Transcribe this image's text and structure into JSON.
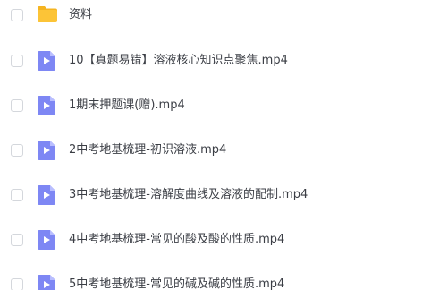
{
  "files": [
    {
      "type": "folder",
      "name": "资料"
    },
    {
      "type": "video",
      "name": "10【真题易错】溶液核心知识点聚焦.mp4"
    },
    {
      "type": "video",
      "name": "1期末押题课(赠).mp4"
    },
    {
      "type": "video",
      "name": "2中考地基梳理-初识溶液.mp4"
    },
    {
      "type": "video",
      "name": "3中考地基梳理-溶解度曲线及溶液的配制.mp4"
    },
    {
      "type": "video",
      "name": "4中考地基梳理-常见的酸及酸的性质.mp4"
    },
    {
      "type": "video",
      "name": "5中考地基梳理-常见的碱及碱的性质.mp4"
    }
  ],
  "colors": {
    "folder": "#fcc437",
    "folder_tab": "#f5b420",
    "video": "#7e87f4",
    "video_fold": "#b9beff",
    "text": "#3b3e45",
    "checkbox_border": "#d4d7dc"
  },
  "icons": {
    "folder": "folder-icon",
    "video": "video-file-icon"
  }
}
